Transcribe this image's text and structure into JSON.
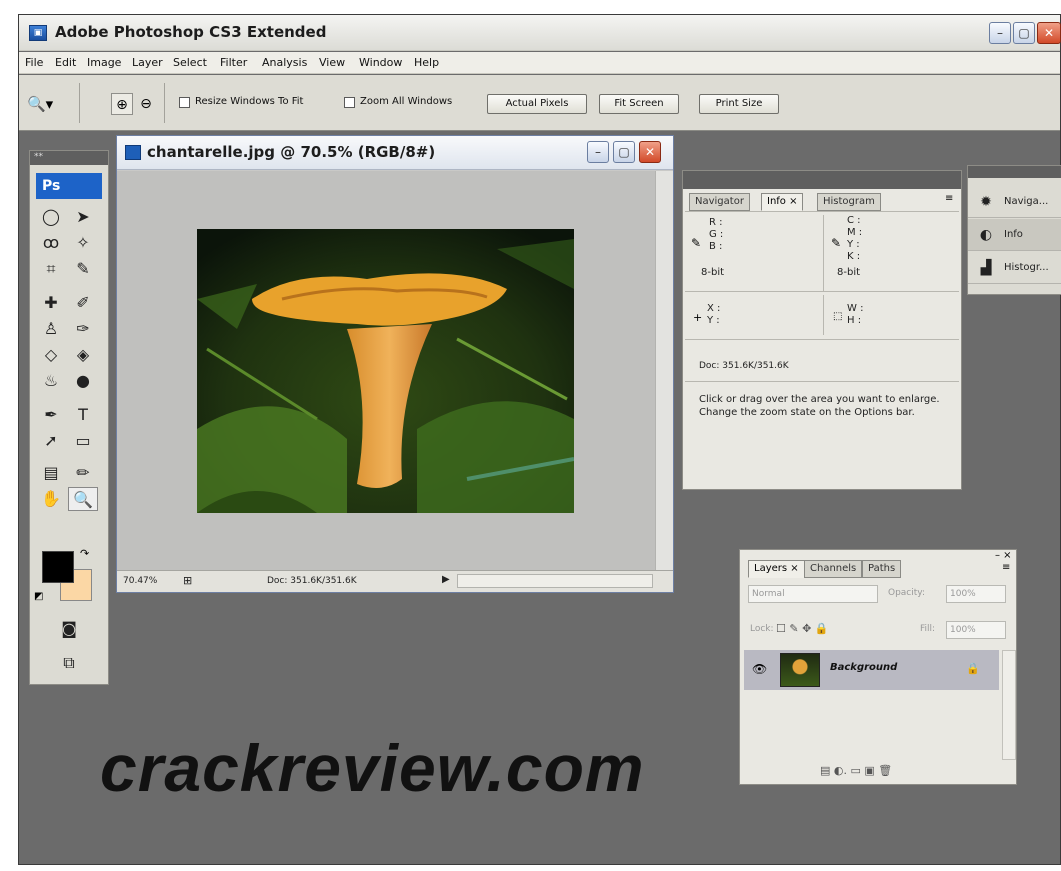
{
  "window": {
    "title": "Adobe Photoshop CS3 Extended",
    "icon": "ps-app-icon",
    "controls": [
      "minimize",
      "maximize",
      "close"
    ]
  },
  "menubar": [
    "File",
    "Edit",
    "Image",
    "Layer",
    "Select",
    "Filter",
    "Analysis",
    "View",
    "Window",
    "Help"
  ],
  "options_bar": {
    "resize_windows_label": "Resize Windows To Fit",
    "zoom_all_label": "Zoom All Windows",
    "actual_pixels": "Actual Pixels",
    "fit_screen": "Fit Screen",
    "print_size": "Print Size"
  },
  "toolbox": {
    "logo": "Ps",
    "grip": "**",
    "foreground_color": "#000000",
    "background_color": "#fbd7a5"
  },
  "document": {
    "title": "chantarelle.jpg @ 70.5% (RGB/8#)",
    "zoom": "70.47%",
    "doc_size": "Doc: 351.6K/351.6K"
  },
  "info_panel": {
    "tabs": [
      "Navigator",
      "Info ×",
      "Histogram"
    ],
    "rgb_labels": [
      "R :",
      "G :",
      "B :"
    ],
    "cmyk_labels": [
      "C :",
      "M :",
      "Y :",
      "K :"
    ],
    "bit_left": "8-bit",
    "bit_right": "8-bit",
    "xy_labels": [
      "X :",
      "Y :"
    ],
    "wh_labels": [
      "W :",
      "H :"
    ],
    "doc": "Doc: 351.6K/351.6K",
    "help": "Click or drag over the area you want to enlarge. Change the zoom state on the Options bar."
  },
  "dock": [
    {
      "label": "Naviga...",
      "icon": "navigator-icon"
    },
    {
      "label": "Info",
      "icon": "info-icon"
    },
    {
      "label": "Histogr...",
      "icon": "histogram-icon"
    }
  ],
  "layers_panel": {
    "tabs": [
      "Layers ×",
      "Channels",
      "Paths"
    ],
    "blend_mode": "Normal",
    "opacity_label": "Opacity:",
    "opacity": "100%",
    "lock_label": "Lock:",
    "fill_label": "Fill:",
    "fill": "100%",
    "layer_name": "Background"
  },
  "watermark": "crackreview.com"
}
